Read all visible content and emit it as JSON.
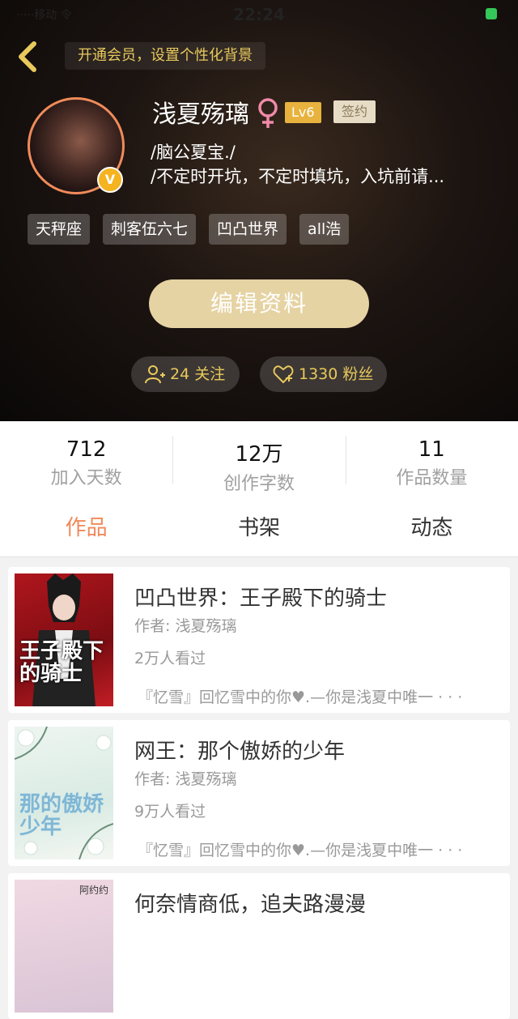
{
  "status_bar": {
    "carrier": "·····移动 令",
    "time": "22:24"
  },
  "header": {
    "vip_banner": "开通会员，设置个性化背景",
    "username": "浅夏殇璃",
    "gender_symbol": "♀",
    "level": "Lv6",
    "signed": "签约",
    "avatar_badge": "V",
    "bio_line1": "/脑公夏宝./",
    "bio_line2": "/不定时开坑，不定时填坑，入坑前请...",
    "tags": [
      "天秤座",
      "刺客伍六七",
      "凹凸世界",
      "all浩"
    ],
    "edit_button": "编辑资料",
    "following": "24 关注",
    "fans": "1330 粉丝"
  },
  "stats": [
    {
      "value": "712",
      "label": "加入天数"
    },
    {
      "value": "12万",
      "label": "创作字数"
    },
    {
      "value": "11",
      "label": "作品数量"
    }
  ],
  "tabs": [
    "作品",
    "书架",
    "动态"
  ],
  "books": [
    {
      "title": "凹凸世界：王子殿下的骑士",
      "author": "作者: 浅夏殇璃",
      "views": "2万人看过",
      "desc": "『忆雪』回忆雪中的你♥.—你是浅夏中唯一 · · ·",
      "cover_text": "王子殿下的骑士"
    },
    {
      "title": "网王：那个傲娇的少年",
      "author": "作者: 浅夏殇璃",
      "views": "9万人看过",
      "desc": "『忆雪』回忆雪中的你♥.—你是浅夏中唯一 · · ·",
      "cover_text": "那的傲娇少年"
    },
    {
      "title": "何奈情商低，追夫路漫漫",
      "author": "",
      "views": "",
      "desc": "",
      "cover_text": "阿约约"
    }
  ],
  "colors": {
    "accent": "#f0895a",
    "gold": "#e8c95c",
    "button": "#e6d3a3"
  }
}
